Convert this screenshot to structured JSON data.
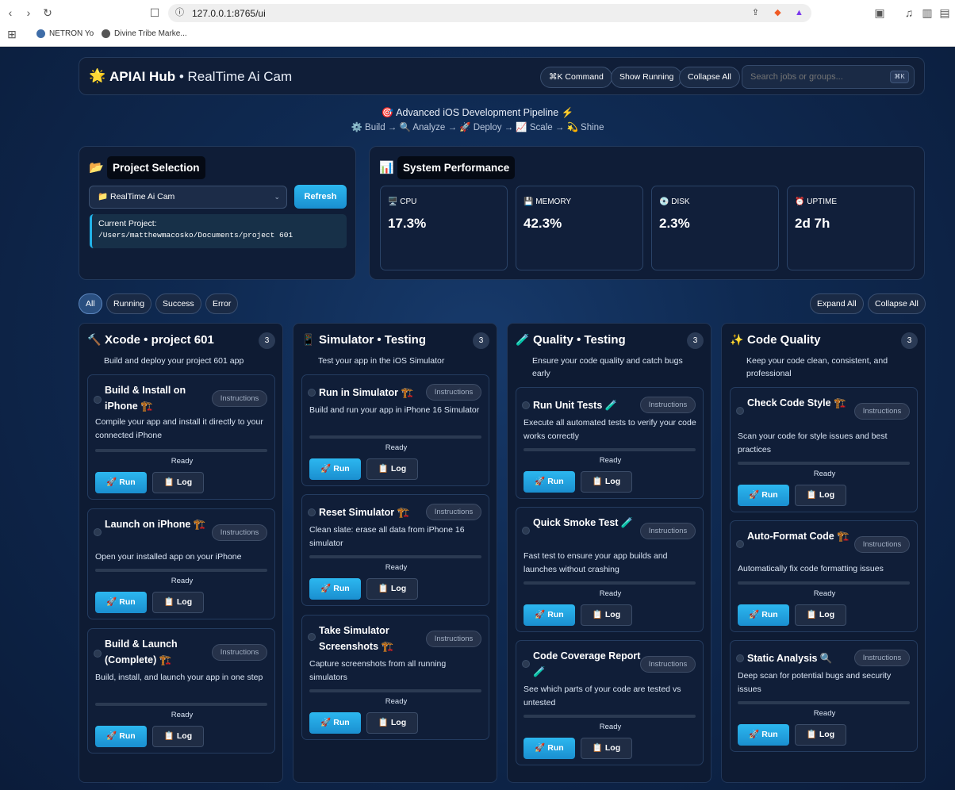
{
  "browser": {
    "url": "127.0.0.1:8765/ui",
    "bookmarks": [
      "NETRON Yo",
      "Divine Tribe Marke..."
    ]
  },
  "app": {
    "title": "APIAI Hub",
    "subtitle": " • RealTime Ai Cam",
    "command_label": "⌘K Command",
    "show_running_label": "Show Running",
    "collapse_all_label": "Collapse All",
    "search_placeholder": "Search jobs or groups...",
    "search_kbd": "⌘K"
  },
  "tagline": {
    "line1": "🎯 Advanced iOS Development Pipeline ⚡",
    "line2": "⚙️ Build → 🔍 Analyze → 🚀 Deploy → 📈 Scale → 💫 Shine"
  },
  "project": {
    "title": "Project Selection",
    "selected": "📁 RealTime Ai Cam",
    "refresh_label": "Refresh",
    "current_label": "Current Project:",
    "current_path": "/Users/matthewmacosko/Documents/project 601"
  },
  "performance": {
    "title": "System Performance",
    "stats": [
      {
        "label": "🖥️ CPU",
        "value": "17.3%"
      },
      {
        "label": "💾 MEMORY",
        "value": "42.3%"
      },
      {
        "label": "💿 DISK",
        "value": "2.3%"
      },
      {
        "label": "⏰ UPTIME",
        "value": "2d 7h"
      }
    ]
  },
  "filters": {
    "all": "All",
    "running": "Running",
    "success": "Success",
    "error": "Error",
    "expand_all": "Expand All",
    "collapse_all": "Collapse All"
  },
  "columns": [
    {
      "icon": "🔨",
      "title": "Xcode • project 601",
      "count": "3",
      "desc": "Build and deploy your project 601 app",
      "jobs": [
        {
          "title": "Build & Install on iPhone 🏗️",
          "desc": "Compile your app and install it directly to your connected iPhone",
          "status": "Ready"
        },
        {
          "title": "Launch on iPhone 🏗️",
          "desc": "Open your installed app on your iPhone",
          "status": "Ready"
        },
        {
          "title": "Build & Launch (Complete) 🏗️",
          "desc": "Build, install, and launch your app in one step",
          "status": "Ready"
        }
      ]
    },
    {
      "icon": "📱",
      "title": "Simulator • Testing",
      "count": "3",
      "desc": "Test your app in the iOS Simulator",
      "jobs": [
        {
          "title": "Run in Simulator 🏗️",
          "desc": "Build and run your app in iPhone 16 Simulator",
          "status": "Ready"
        },
        {
          "title": "Reset Simulator 🏗️",
          "desc": "Clean slate: erase all data from iPhone 16 simulator",
          "status": "Ready"
        },
        {
          "title": "Take Simulator Screenshots 🏗️",
          "desc": "Capture screenshots from all running simulators",
          "status": "Ready"
        }
      ]
    },
    {
      "icon": "🧪",
      "title": "Quality • Testing",
      "count": "3",
      "desc": "Ensure your code quality and catch bugs early",
      "jobs": [
        {
          "title": "Run Unit Tests 🧪",
          "desc": "Execute all automated tests to verify your code works correctly",
          "status": "Ready"
        },
        {
          "title": "Quick Smoke Test 🧪",
          "desc": "Fast test to ensure your app builds and launches without crashing",
          "status": "Ready"
        },
        {
          "title": "Code Coverage Report 🧪",
          "desc": "See which parts of your code are tested vs untested",
          "status": "Ready"
        }
      ]
    },
    {
      "icon": "✨",
      "title": "Code Quality",
      "count": "3",
      "desc": "Keep your code clean, consistent, and professional",
      "jobs": [
        {
          "title": "Check Code Style 🏗️",
          "desc": "Scan your code for style issues and best practices",
          "status": "Ready"
        },
        {
          "title": "Auto-Format Code 🏗️",
          "desc": "Automatically fix code formatting issues",
          "status": "Ready"
        },
        {
          "title": "Static Analysis 🔍",
          "desc": "Deep scan for potential bugs and security issues",
          "status": "Ready"
        }
      ]
    }
  ],
  "labels": {
    "instructions": "Instructions",
    "run": "🚀 Run",
    "log": "📋 Log"
  }
}
